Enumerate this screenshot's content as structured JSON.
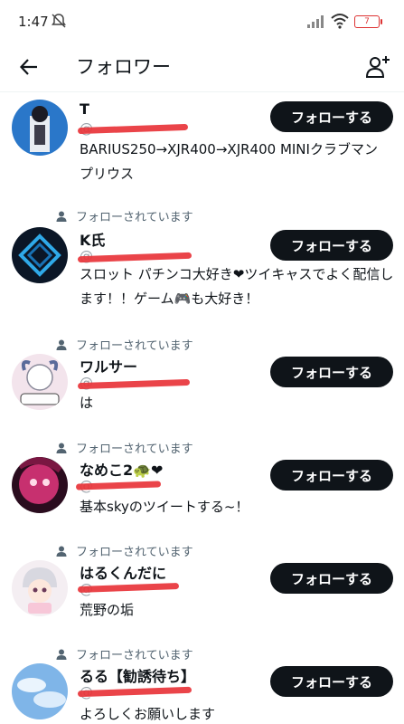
{
  "status_bar": {
    "time": "1:47",
    "battery": "7"
  },
  "header": {
    "title": "フォロワー"
  },
  "follows_you_label": "フォローされています",
  "follow_button_label": "フォローする",
  "users": [
    {
      "name": "T",
      "handle": "@",
      "bio": "BARIUS250→XJR400→XJR400 MINIクラブマン　プリウス"
    },
    {
      "name": "K氏",
      "handle": "@",
      "bio": "スロット パチンコ大好き❤ツイキャスでよく配信します！！ゲーム🎮も大好き！"
    },
    {
      "name": "ワルサー",
      "handle": "@",
      "bio": "は"
    },
    {
      "name": "なめこ2🐢❤",
      "handle": "@",
      "bio": "基本skyのツイートする~！"
    },
    {
      "name": "はるくんだに",
      "handle": "@",
      "bio": "荒野の垢"
    },
    {
      "name": "るる【勧誘待ち】",
      "handle": "@",
      "bio": "よろしくお願いします"
    }
  ]
}
